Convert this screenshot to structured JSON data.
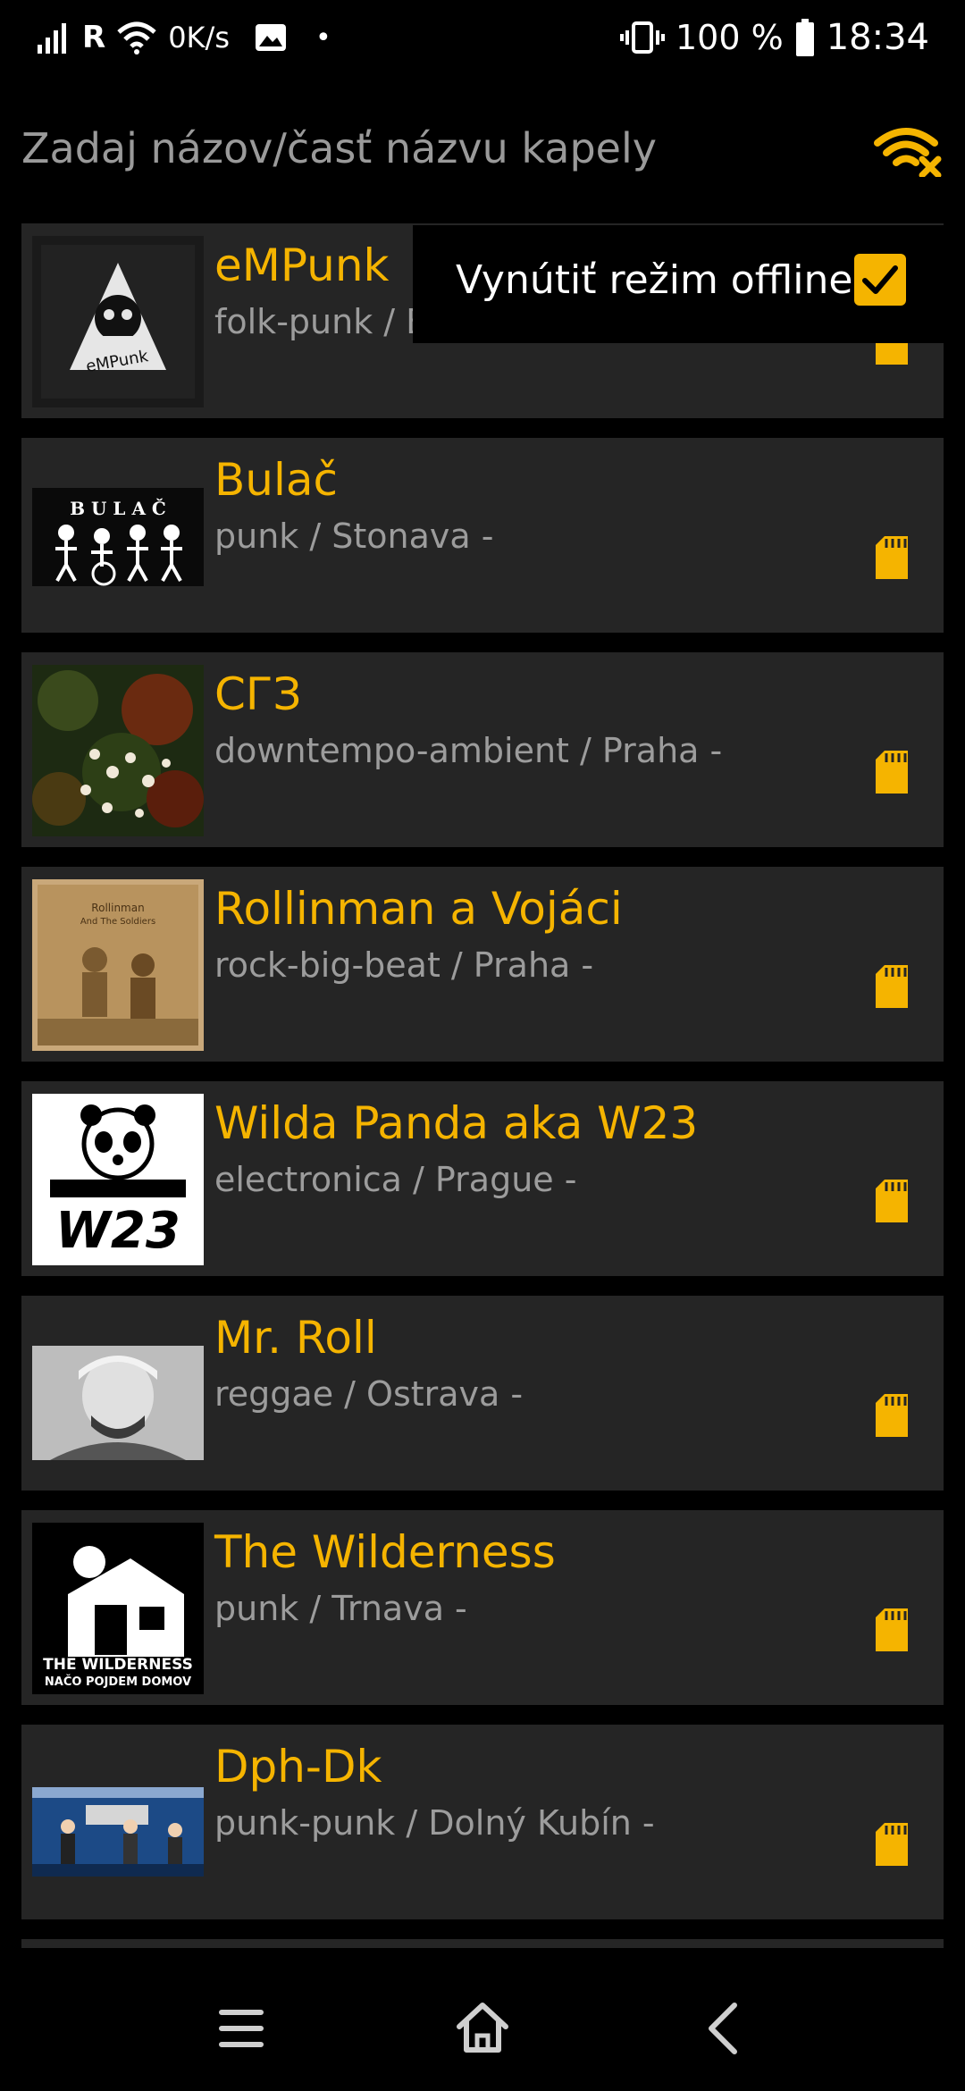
{
  "status_bar": {
    "signal_label": "R",
    "net_speed": "0K/s",
    "dot": "•",
    "battery_percent": "100 %",
    "time": "18:34"
  },
  "search": {
    "placeholder": "Zadaj názov/časť názvu kapely"
  },
  "popup": {
    "label": "Vynútiť režim offline",
    "checked": true
  },
  "bands": [
    {
      "name": "eMPunk",
      "info": "folk-punk / Bratislava -",
      "thumb": "empunk"
    },
    {
      "name": "Bulač",
      "info": "punk / Stonava -",
      "thumb": "bulac"
    },
    {
      "name": "СГЗ",
      "info": "downtempo-ambient / Praha -",
      "thumb": "flowers"
    },
    {
      "name": "Rollinman a Vojáci",
      "info": "rock-big-beat / Praha -",
      "thumb": "sepia"
    },
    {
      "name": "Wilda Panda aka W23",
      "info": "electronica / Prague -",
      "thumb": "w23"
    },
    {
      "name": "Mr. Roll",
      "info": "reggae / Ostrava -",
      "thumb": "portrait"
    },
    {
      "name": "The Wilderness",
      "info": "punk / Trnava -",
      "thumb": "wilderness"
    },
    {
      "name": "Dph-Dk",
      "info": "punk-punk / Dolný Kubín -",
      "thumb": "stage"
    }
  ],
  "thumb_text": {
    "empunk": "eMPunk",
    "bulac": "B U L A Č",
    "sepia_line1": "Rollinman",
    "sepia_line2": "And The Soldiers",
    "w23": "W23",
    "wilderness_line1": "THE WILDERNESS",
    "wilderness_line2": "NAČO POJDEM DOMOV"
  },
  "colors": {
    "accent": "#f5b400",
    "item_bg": "#252525",
    "secondary_text": "#9c9c9c",
    "background": "#000000"
  },
  "icons": {
    "offline": "wifi-off-icon",
    "storage": "sd-card-icon",
    "nav_menu": "menu-icon",
    "nav_home": "home-icon",
    "nav_back": "back-icon"
  }
}
